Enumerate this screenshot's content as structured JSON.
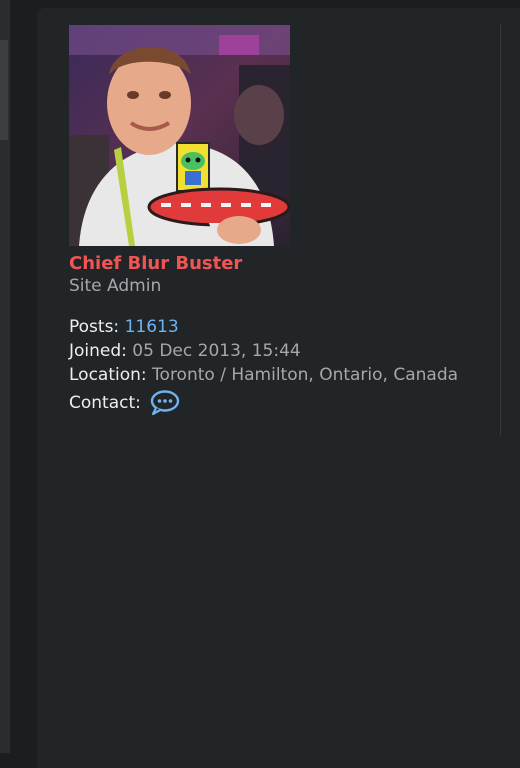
{
  "profile": {
    "username": "Chief Blur Buster",
    "rank": "Site Admin",
    "posts_label": "Posts:",
    "posts_value": "11613",
    "joined_label": "Joined:",
    "joined_value": "05 Dec 2013, 15:44",
    "location_label": "Location:",
    "location_value": "Toronto / Hamilton, Ontario, Canada",
    "contact_label": "Contact:",
    "contact_icon": "chat-bubble-icon"
  },
  "colors": {
    "username": "#f25454",
    "link": "#6fb3f0",
    "panel": "#222527"
  }
}
